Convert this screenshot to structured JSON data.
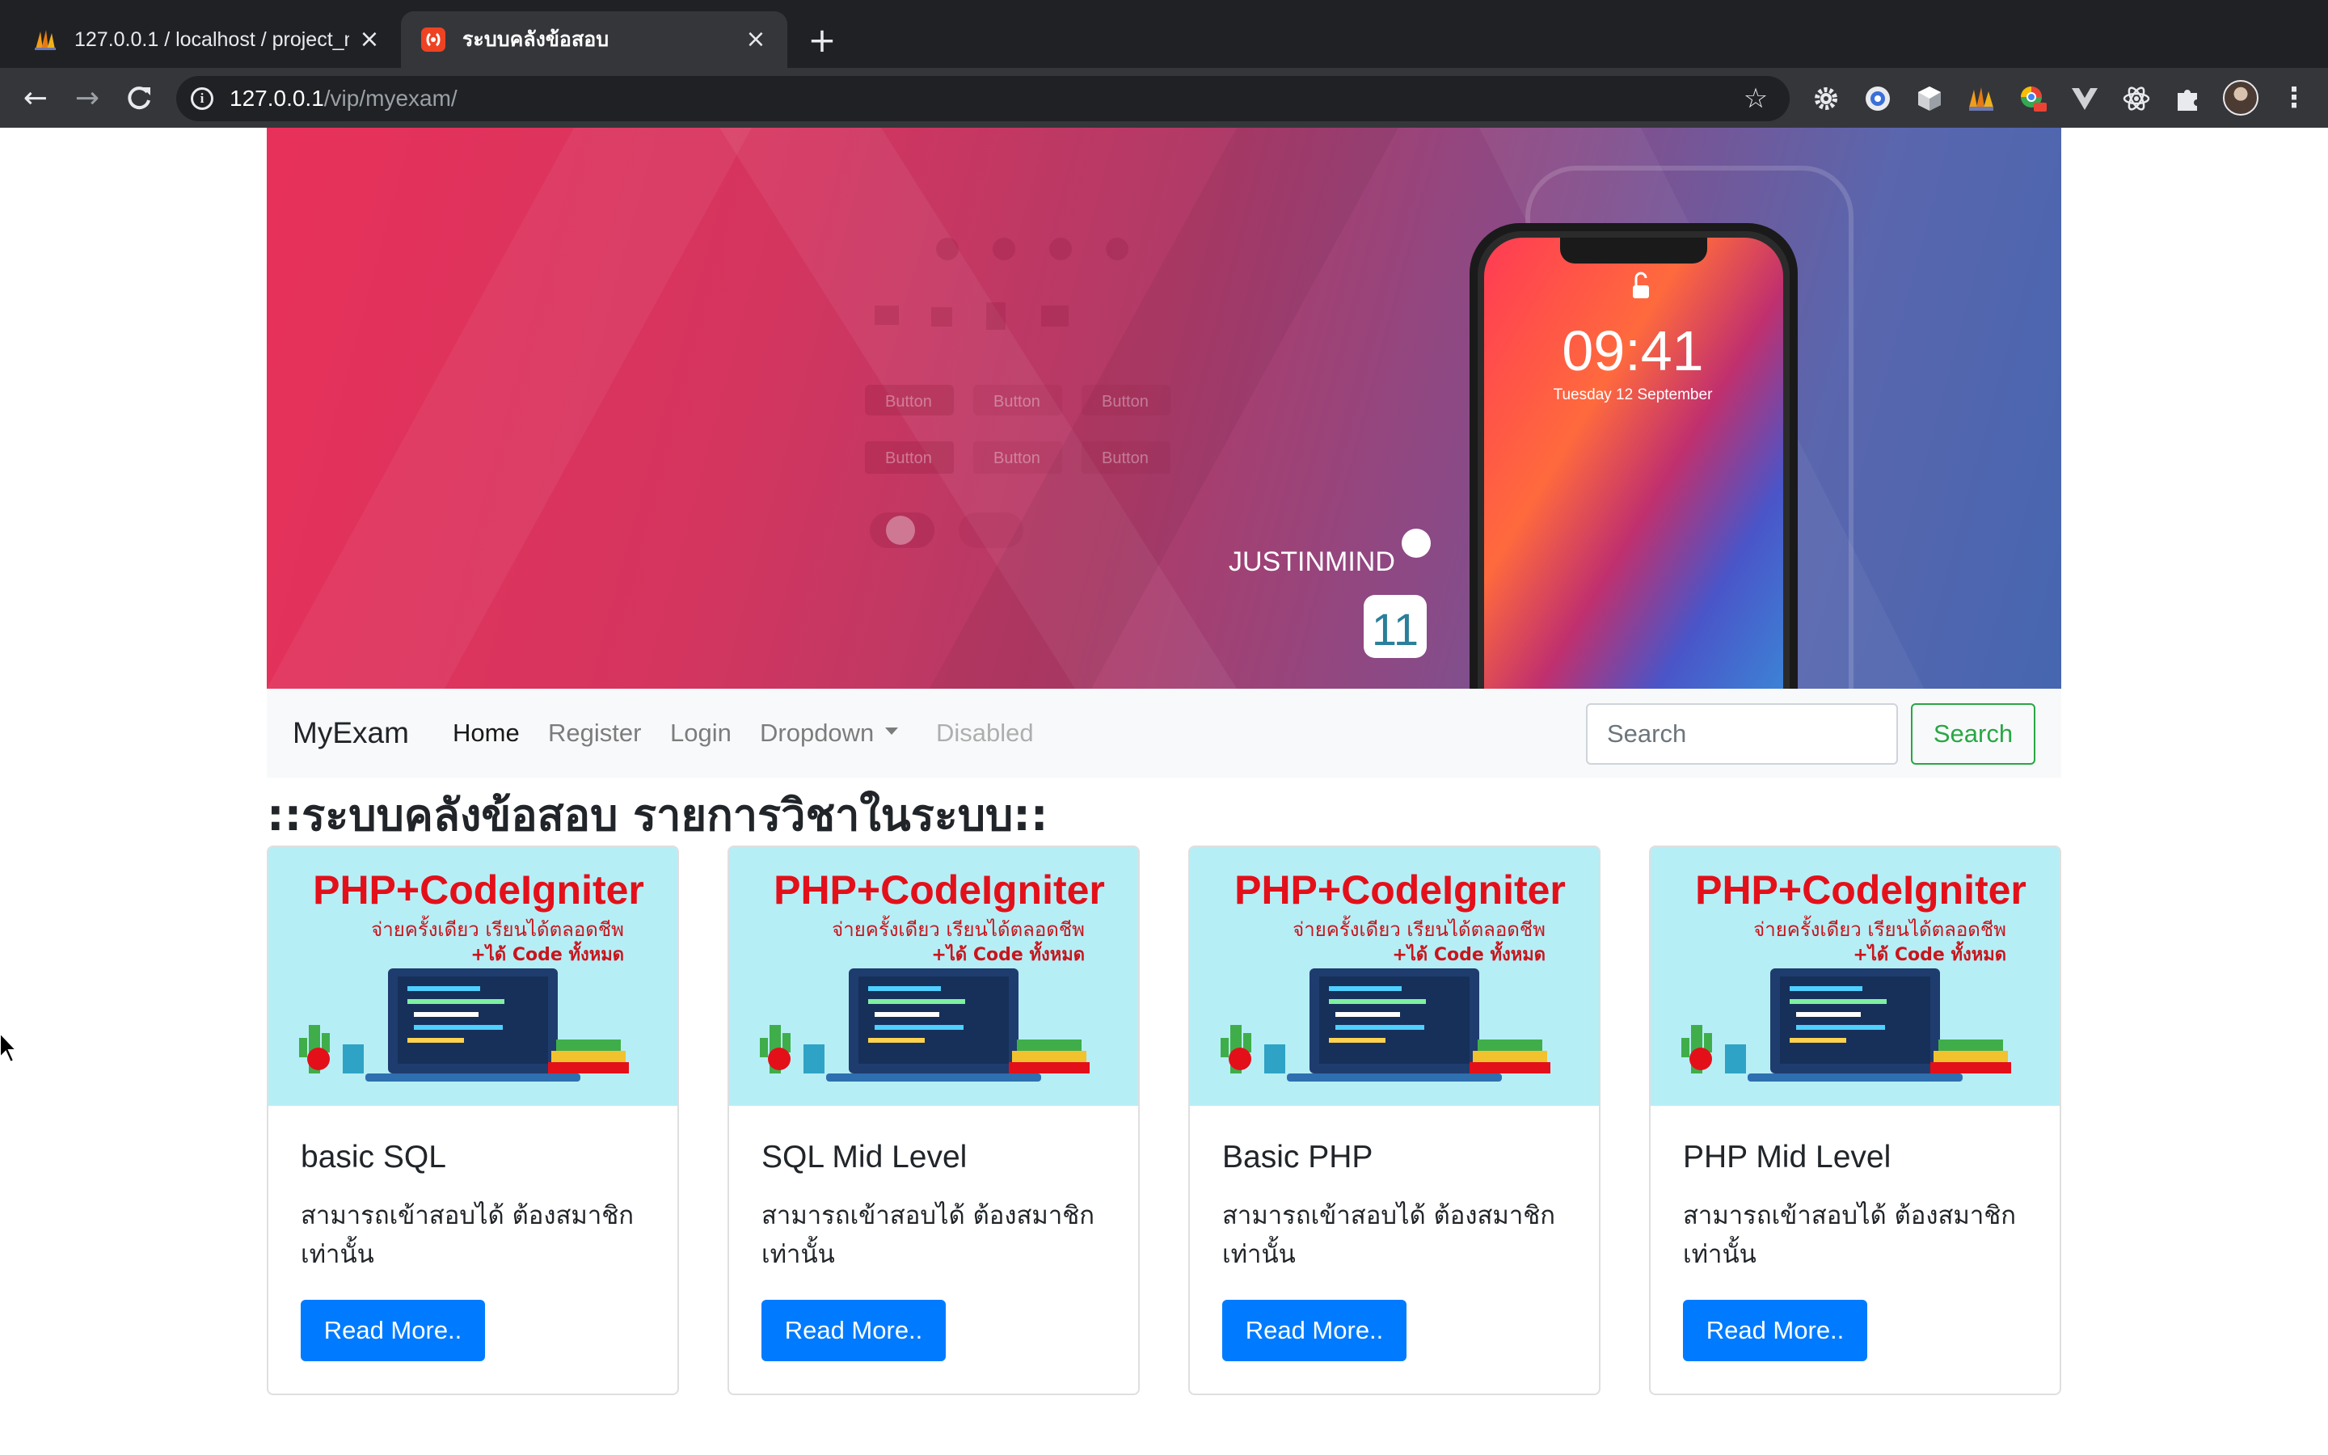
{
  "browser": {
    "tabs": [
      {
        "title": "127.0.0.1 / localhost / project_n",
        "icon": "phpmyadmin-icon",
        "active": false
      },
      {
        "title": "ระบบคลังข้อสอบ",
        "icon": "codeigniter-icon",
        "active": true
      }
    ],
    "url": {
      "host": "127.0.0.1",
      "path": "/vip/myexam/"
    },
    "extensions": [
      "gear-icon",
      "circle-extension-icon",
      "cube-icon",
      "pma-icon",
      "chrome-extension-icon",
      "vue-icon",
      "react-icon",
      "puzzle-icon"
    ]
  },
  "hero": {
    "time": "09:41",
    "date": "Tuesday 12 September",
    "logo_text": "JUSTINMIND",
    "version_badge": "11",
    "ghost_button_label": "Button"
  },
  "navbar": {
    "brand": "MyExam",
    "links": [
      {
        "label": "Home",
        "state": "active"
      },
      {
        "label": "Register",
        "state": "normal"
      },
      {
        "label": "Login",
        "state": "normal"
      },
      {
        "label": "Dropdown",
        "state": "dropdown"
      },
      {
        "label": "Disabled",
        "state": "disabled"
      }
    ],
    "search_placeholder": "Search",
    "search_button": "Search"
  },
  "page_heading": "::ระบบคลังข้อสอบ รายการวิชาในระบบ::",
  "card_image": {
    "headline": "PHP+CodeIgniter",
    "line1": "จ่ายครั้งเดียว เรียนได้ตลอดชีพ",
    "line2": "+ได้ Code ทั้งหมด"
  },
  "cards": [
    {
      "title": "basic SQL",
      "text": "สามารถเข้าสอบได้ ต้องสมาชิกเท่านั้น",
      "button": "Read More.."
    },
    {
      "title": "SQL Mid Level",
      "text": "สามารถเข้าสอบได้ ต้องสมาชิกเท่านั้น",
      "button": "Read More.."
    },
    {
      "title": "Basic PHP",
      "text": "สามารถเข้าสอบได้ ต้องสมาชิกเท่านั้น",
      "button": "Read More.."
    },
    {
      "title": "PHP Mid Level",
      "text": "สามารถเข้าสอบได้ ต้องสมาชิกเท่านั้น",
      "button": "Read More.."
    }
  ],
  "colors": {
    "primary": "#007bff",
    "success": "#28a745",
    "navbar_bg": "#f8f9fa",
    "chrome_dark": "#202124",
    "chrome_toolbar": "#35363a"
  }
}
